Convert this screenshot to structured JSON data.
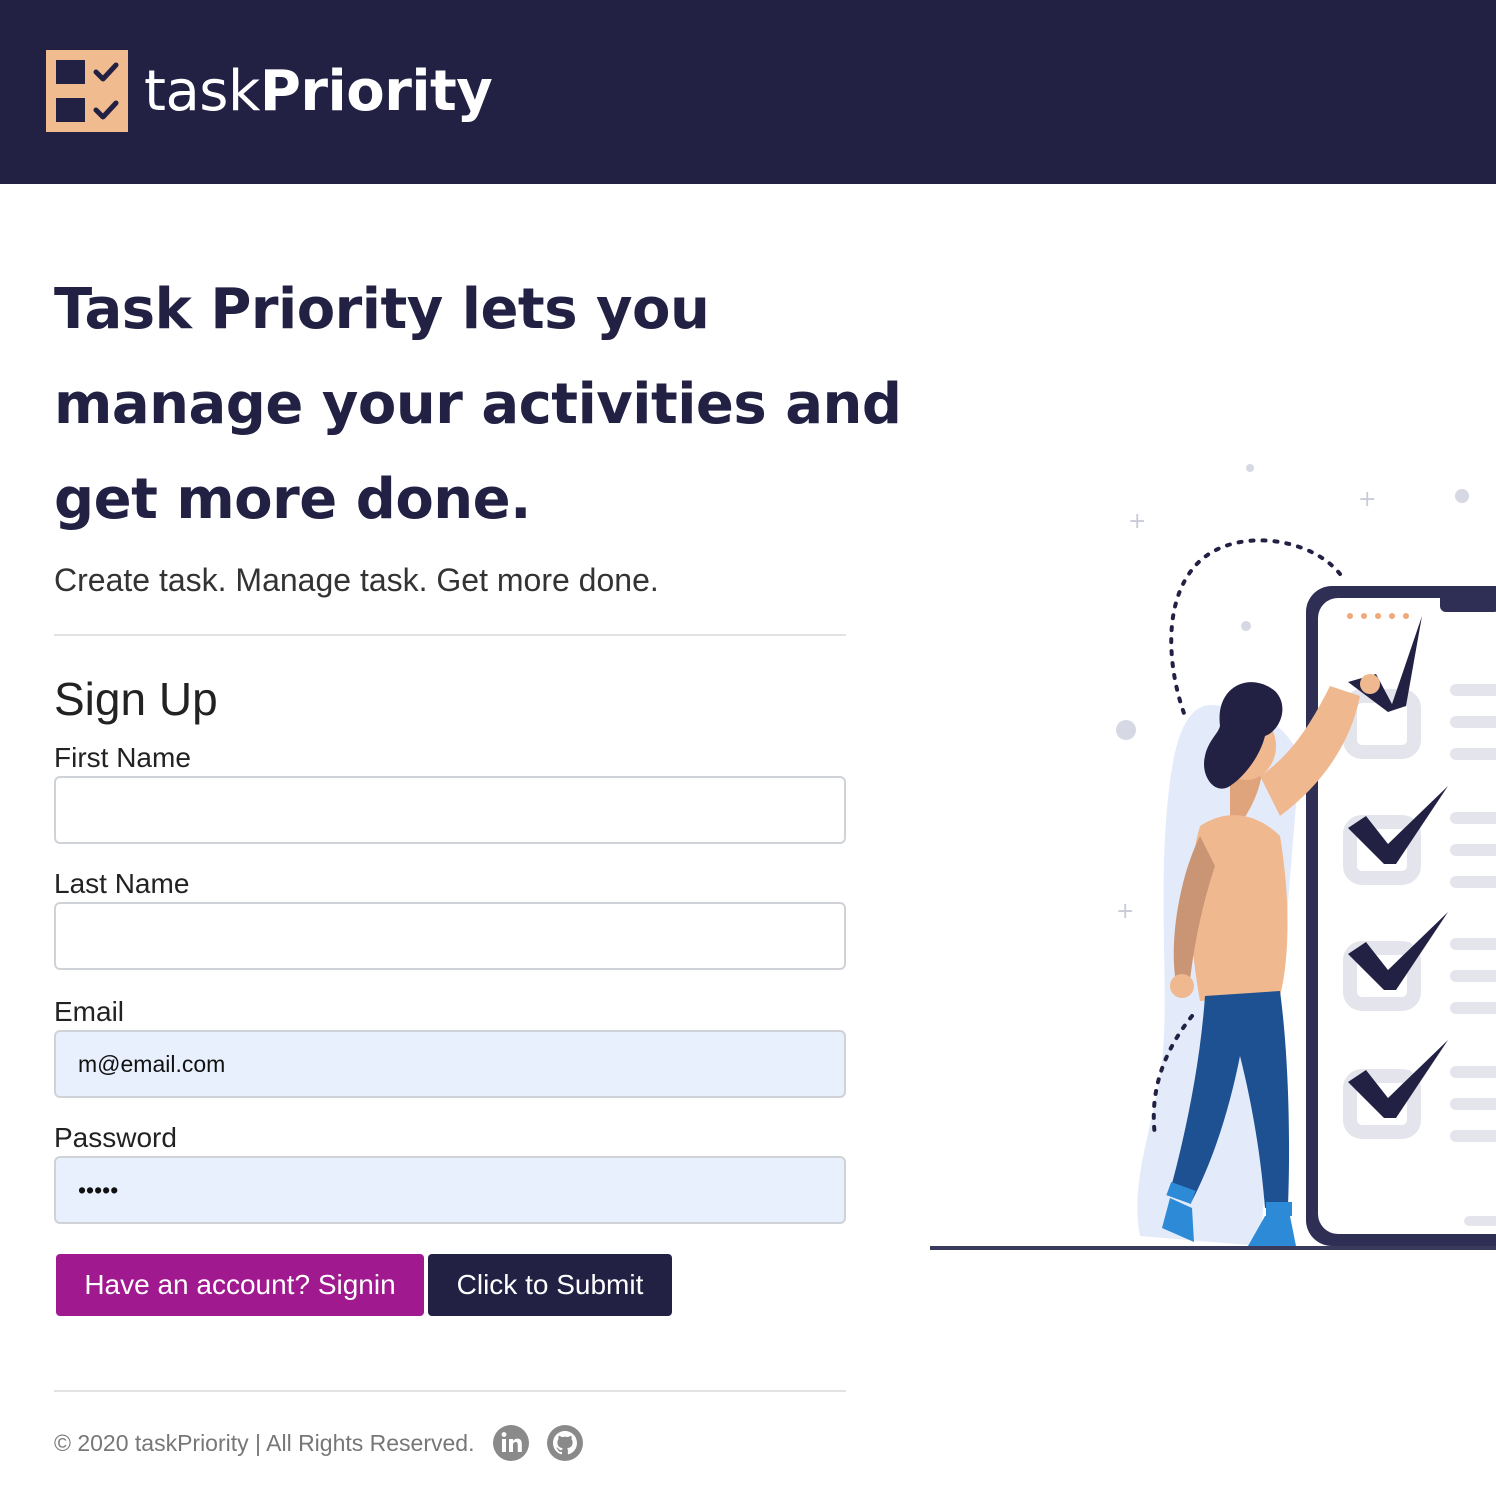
{
  "header": {
    "brand_light": "task",
    "brand_bold": "Priority"
  },
  "hero": {
    "title": "Task Priority lets you manage your activities and get more done.",
    "subtitle": "Create task. Manage task. Get more done."
  },
  "form": {
    "title": "Sign Up",
    "fields": [
      {
        "label": "First Name",
        "value": ""
      },
      {
        "label": "Last Name",
        "value": ""
      },
      {
        "label": "Email",
        "value": "m@email.com"
      },
      {
        "label": "Password",
        "value": "•••••"
      }
    ],
    "signin_label": "Have an account? Signin",
    "submit_label": "Click to Submit"
  },
  "footer": {
    "copyright": "© 2020 taskPriority | All Rights Reserved.",
    "social_icons": [
      "linkedin-icon",
      "github-icon"
    ]
  },
  "colors": {
    "navy": "#222144",
    "magenta": "#a0198e",
    "logo_peach": "#f0bb8e",
    "autofill": "#e8f0fe"
  }
}
